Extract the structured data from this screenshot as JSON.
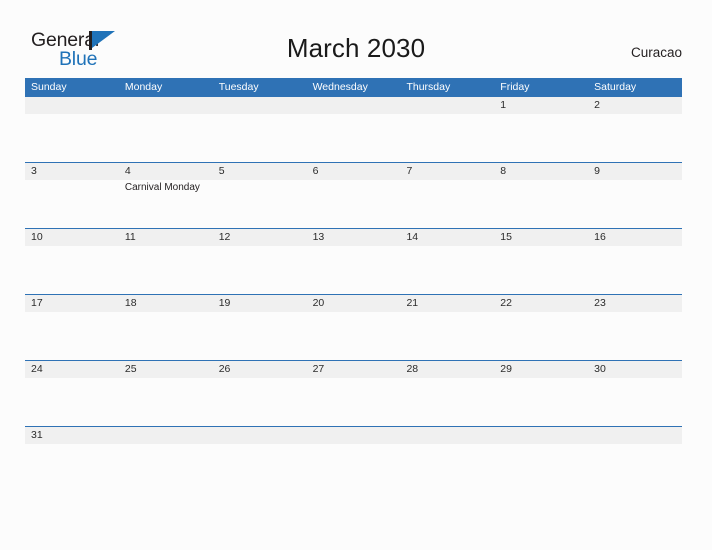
{
  "brand": {
    "line1": "General",
    "line2": "Blue",
    "flag_icon": "blue-flag-triangle",
    "accent_color": "#1f72b8",
    "text_color": "#231f20"
  },
  "header": {
    "title": "March 2030",
    "location": "Curacao"
  },
  "calendar": {
    "header_bg_color": "#2f72b5",
    "day_band_color": "#f0f0f0",
    "grid_line_color": "#2f72b5",
    "month": "March",
    "year": "2030",
    "weekday_headers": [
      "Sunday",
      "Monday",
      "Tuesday",
      "Wednesday",
      "Thursday",
      "Friday",
      "Saturday"
    ],
    "weeks": [
      [
        {
          "date": "",
          "events": []
        },
        {
          "date": "",
          "events": []
        },
        {
          "date": "",
          "events": []
        },
        {
          "date": "",
          "events": []
        },
        {
          "date": "",
          "events": []
        },
        {
          "date": "1",
          "events": []
        },
        {
          "date": "2",
          "events": []
        }
      ],
      [
        {
          "date": "3",
          "events": []
        },
        {
          "date": "4",
          "events": [
            "Carnival Monday"
          ]
        },
        {
          "date": "5",
          "events": []
        },
        {
          "date": "6",
          "events": []
        },
        {
          "date": "7",
          "events": []
        },
        {
          "date": "8",
          "events": []
        },
        {
          "date": "9",
          "events": []
        }
      ],
      [
        {
          "date": "10",
          "events": []
        },
        {
          "date": "11",
          "events": []
        },
        {
          "date": "12",
          "events": []
        },
        {
          "date": "13",
          "events": []
        },
        {
          "date": "14",
          "events": []
        },
        {
          "date": "15",
          "events": []
        },
        {
          "date": "16",
          "events": []
        }
      ],
      [
        {
          "date": "17",
          "events": []
        },
        {
          "date": "18",
          "events": []
        },
        {
          "date": "19",
          "events": []
        },
        {
          "date": "20",
          "events": []
        },
        {
          "date": "21",
          "events": []
        },
        {
          "date": "22",
          "events": []
        },
        {
          "date": "23",
          "events": []
        }
      ],
      [
        {
          "date": "24",
          "events": []
        },
        {
          "date": "25",
          "events": []
        },
        {
          "date": "26",
          "events": []
        },
        {
          "date": "27",
          "events": []
        },
        {
          "date": "28",
          "events": []
        },
        {
          "date": "29",
          "events": []
        },
        {
          "date": "30",
          "events": []
        }
      ],
      [
        {
          "date": "31",
          "events": []
        },
        {
          "date": "",
          "events": []
        },
        {
          "date": "",
          "events": []
        },
        {
          "date": "",
          "events": []
        },
        {
          "date": "",
          "events": []
        },
        {
          "date": "",
          "events": []
        },
        {
          "date": "",
          "events": []
        }
      ]
    ]
  }
}
